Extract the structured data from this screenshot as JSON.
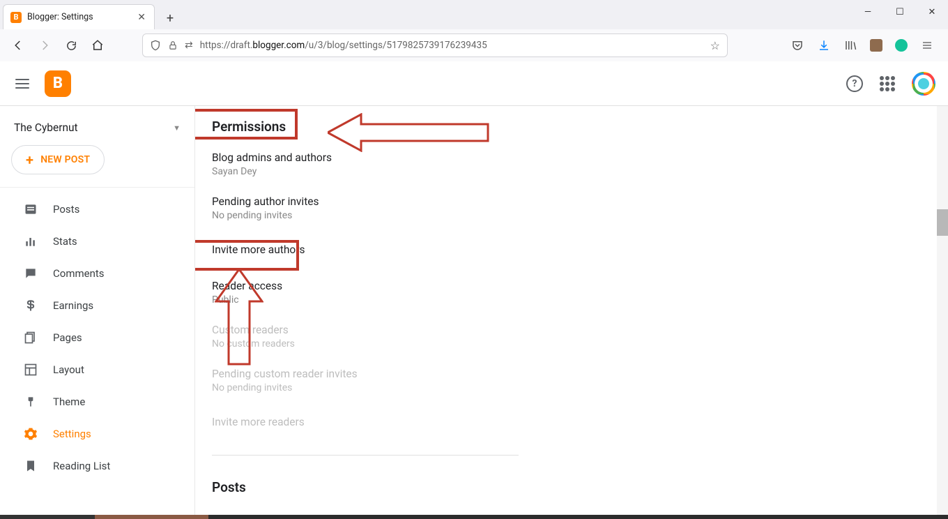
{
  "browser": {
    "tab": {
      "title": "Blogger: Settings"
    },
    "url": {
      "prefix": "https://draft.",
      "host": "blogger.com",
      "path": "/u/3/blog/settings/5179825739176239435"
    }
  },
  "header": {
    "logo_letter": "B"
  },
  "sidebar": {
    "blog_name": "The Cybernut",
    "new_post": "NEW POST",
    "items": [
      {
        "label": "Posts"
      },
      {
        "label": "Stats"
      },
      {
        "label": "Comments"
      },
      {
        "label": "Earnings"
      },
      {
        "label": "Pages"
      },
      {
        "label": "Layout"
      },
      {
        "label": "Theme"
      },
      {
        "label": "Settings"
      },
      {
        "label": "Reading List"
      }
    ]
  },
  "content": {
    "section_title": "Permissions",
    "rows": {
      "admins": {
        "label": "Blog admins and authors",
        "value": "Sayan Dey"
      },
      "pending_authors": {
        "label": "Pending author invites",
        "value": "No pending invites"
      },
      "invite_authors": {
        "label": "Invite more authors"
      },
      "reader_access": {
        "label": "Reader access",
        "value": "Public"
      },
      "custom_readers": {
        "label": "Custom readers",
        "value": "No custom readers"
      },
      "pending_readers": {
        "label": "Pending custom reader invites",
        "value": "No pending invites"
      },
      "invite_readers": {
        "label": "Invite more readers"
      }
    },
    "next_section_title": "Posts"
  }
}
